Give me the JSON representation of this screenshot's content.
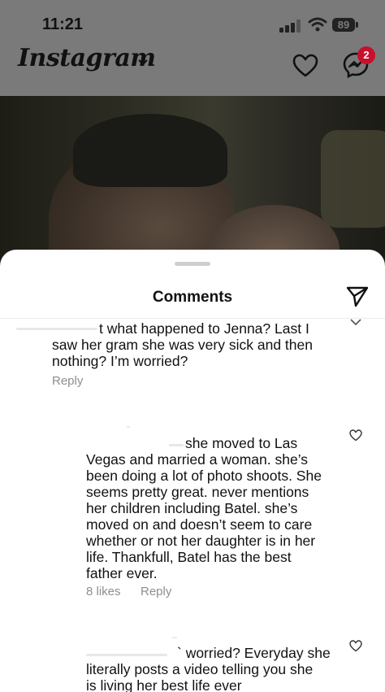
{
  "status_bar": {
    "time": "11:21",
    "battery": "89"
  },
  "header": {
    "logo_text": "Instagram",
    "messages_badge": "2"
  },
  "sheet": {
    "title": "Comments",
    "comments": [
      {
        "lines": [
          "t what happened to Jenna?  Last I",
          "saw her gram she was very sick and then",
          "nothing?  I’m worried?"
        ],
        "reply_label": "Reply"
      },
      {
        "lines": [
          "she moved to Las",
          "Vegas and married a woman. she’s",
          "been doing a lot of photo shoots. She",
          "seems pretty great. never mentions",
          "her children including Batel. she’s",
          "moved on and doesn’t seem to care",
          "whether or not her daughter is in her",
          "life. Thankfull, Batel has the best",
          "father ever."
        ],
        "likes_label": "8 likes",
        "reply_label": "Reply"
      },
      {
        "lines": [
          "` worried? Everyday she",
          "literally posts a video telling you she",
          "is living her best life ever"
        ]
      }
    ]
  },
  "colors": {
    "dim": "#7a7a7a",
    "badge": "#c8102e",
    "meta": "#8e8e8e"
  },
  "icons": [
    "signal-icon",
    "wifi-icon",
    "battery-icon",
    "chevron-down-icon",
    "heart-icon",
    "messenger-icon",
    "share-icon",
    "like-heart-icon"
  ]
}
